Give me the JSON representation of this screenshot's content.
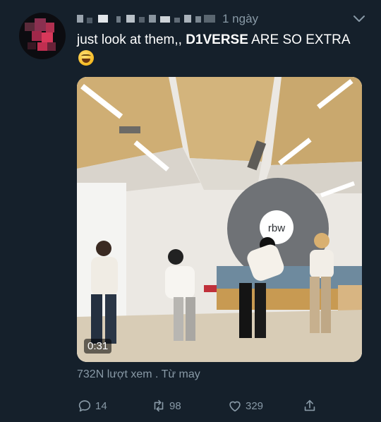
{
  "tweet": {
    "timestamp": "1 ngày",
    "text_start": "just look at them,, ",
    "text_bold": "D1VERSE",
    "text_end": " ARE SO EXTRA",
    "emoji": "grinning-squinting-face",
    "video": {
      "duration": "0:31",
      "logo_text": "rbw"
    },
    "views_text": "732N lượt xem . Từ may",
    "actions": {
      "reply_count": "14",
      "retweet_count": "98",
      "like_count": "329"
    }
  },
  "colors": {
    "background": "#15202b",
    "primary_text": "#ffffff",
    "secondary_text": "#8899a6"
  },
  "icons": [
    "reply-icon",
    "retweet-icon",
    "like-icon",
    "share-icon",
    "caret-down-icon"
  ]
}
